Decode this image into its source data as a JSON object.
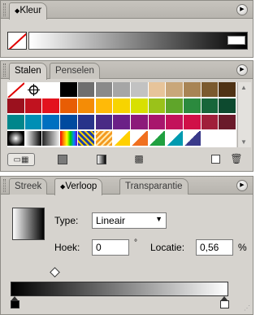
{
  "color_panel": {
    "tab_label": "Kleur",
    "tab_icon": "diamond-toggle-icon",
    "menu_icon": "panel-menu-icon"
  },
  "swatches_panel": {
    "tabs": [
      {
        "label": "Stalen",
        "active": true
      },
      {
        "label": "Penselen",
        "active": false
      }
    ],
    "rows": [
      [
        "none",
        "registration",
        "#ffffff",
        "#000000",
        "#6e6e6e",
        "#8a8a8a",
        "#a6a6a6",
        "#c2c2c2",
        "#e7c49a",
        "#c9a77a",
        "#a88454",
        "#7b5a2e",
        "#4f3214"
      ],
      [
        "#9b111e",
        "#c1121f",
        "#e3121e",
        "#e85d04",
        "#f48c06",
        "#ffba08",
        "#f7d400",
        "#d8e000",
        "#9ac21a",
        "#5fa52a",
        "#2b8a3e",
        "#17663a",
        "#0d4a2f"
      ],
      [
        "#00868b",
        "#008fb5",
        "#0070c0",
        "#004a9f",
        "#28338a",
        "#4a2a85",
        "#6b2187",
        "#8c1a7a",
        "#a8156d",
        "#c3125b",
        "#d01048",
        "#a01f3a",
        "#6a1a2a"
      ],
      [
        "radial-black",
        "gradient-bw",
        "gradient-grey",
        "rainbow",
        "pattern-blue",
        "pattern-orange",
        "pattern-tri-yellow",
        "pattern-tri-orange",
        "pattern-tri-green",
        "pattern-tri-teal",
        "pattern-tri-dark",
        "",
        ""
      ]
    ],
    "toolbar_icons": [
      "show-kinds-icon",
      "color-swatches-icon",
      "gradient-swatches-icon",
      "pattern-swatches-icon",
      "new-swatch-icon",
      "trash-icon"
    ]
  },
  "gradient_panel": {
    "tabs": [
      {
        "label": "Streek",
        "active": false
      },
      {
        "label": "Verloop",
        "active": true
      },
      {
        "label": "Transparantie",
        "active": false
      }
    ],
    "type_label": "Type:",
    "type_value": "Lineair",
    "angle_label": "Hoek:",
    "angle_value": "0",
    "angle_unit": "°",
    "location_label": "Locatie:",
    "location_value": "0,56",
    "location_unit": "%",
    "midpoint_location": 0.56,
    "stops": [
      {
        "color": "#000000",
        "position": 0
      },
      {
        "color": "#ffffff",
        "position": 1
      }
    ]
  }
}
